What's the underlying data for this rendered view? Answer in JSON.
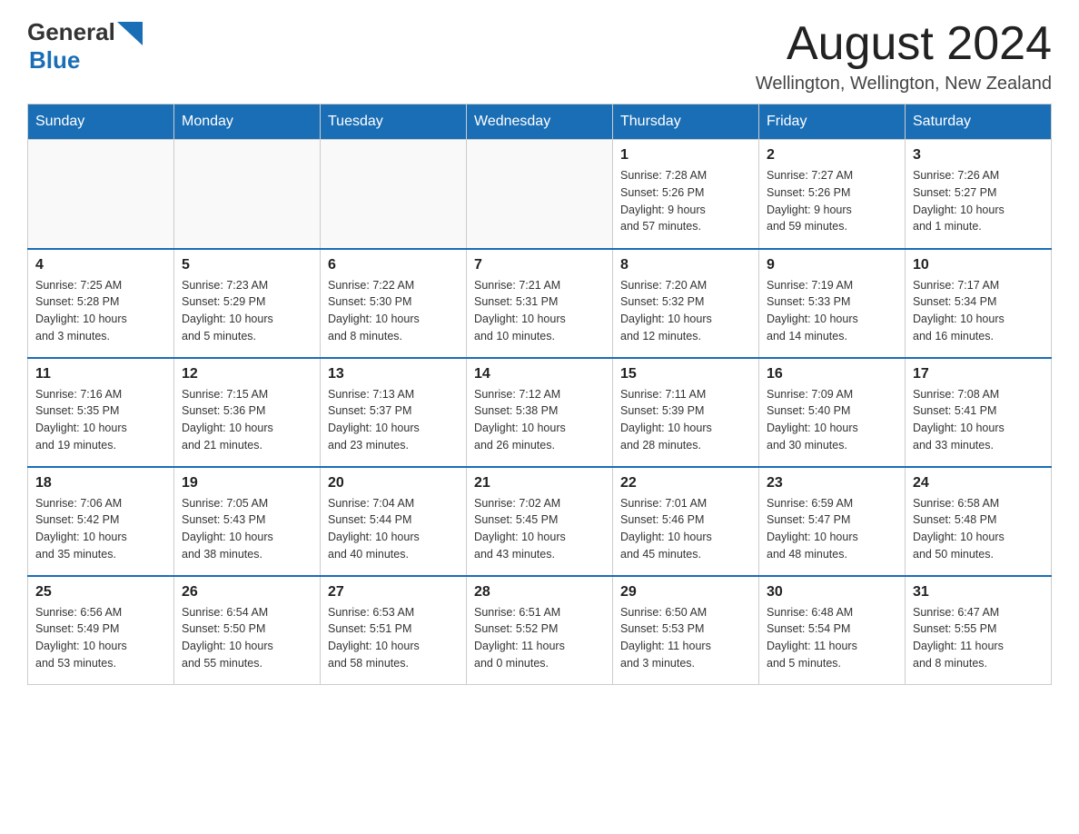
{
  "header": {
    "logo": {
      "general": "General",
      "blue": "Blue"
    },
    "title": "August 2024",
    "location": "Wellington, Wellington, New Zealand"
  },
  "calendar": {
    "days_of_week": [
      "Sunday",
      "Monday",
      "Tuesday",
      "Wednesday",
      "Thursday",
      "Friday",
      "Saturday"
    ],
    "weeks": [
      {
        "days": [
          {
            "date": "",
            "info": ""
          },
          {
            "date": "",
            "info": ""
          },
          {
            "date": "",
            "info": ""
          },
          {
            "date": "",
            "info": ""
          },
          {
            "date": "1",
            "info": "Sunrise: 7:28 AM\nSunset: 5:26 PM\nDaylight: 9 hours\nand 57 minutes."
          },
          {
            "date": "2",
            "info": "Sunrise: 7:27 AM\nSunset: 5:26 PM\nDaylight: 9 hours\nand 59 minutes."
          },
          {
            "date": "3",
            "info": "Sunrise: 7:26 AM\nSunset: 5:27 PM\nDaylight: 10 hours\nand 1 minute."
          }
        ]
      },
      {
        "days": [
          {
            "date": "4",
            "info": "Sunrise: 7:25 AM\nSunset: 5:28 PM\nDaylight: 10 hours\nand 3 minutes."
          },
          {
            "date": "5",
            "info": "Sunrise: 7:23 AM\nSunset: 5:29 PM\nDaylight: 10 hours\nand 5 minutes."
          },
          {
            "date": "6",
            "info": "Sunrise: 7:22 AM\nSunset: 5:30 PM\nDaylight: 10 hours\nand 8 minutes."
          },
          {
            "date": "7",
            "info": "Sunrise: 7:21 AM\nSunset: 5:31 PM\nDaylight: 10 hours\nand 10 minutes."
          },
          {
            "date": "8",
            "info": "Sunrise: 7:20 AM\nSunset: 5:32 PM\nDaylight: 10 hours\nand 12 minutes."
          },
          {
            "date": "9",
            "info": "Sunrise: 7:19 AM\nSunset: 5:33 PM\nDaylight: 10 hours\nand 14 minutes."
          },
          {
            "date": "10",
            "info": "Sunrise: 7:17 AM\nSunset: 5:34 PM\nDaylight: 10 hours\nand 16 minutes."
          }
        ]
      },
      {
        "days": [
          {
            "date": "11",
            "info": "Sunrise: 7:16 AM\nSunset: 5:35 PM\nDaylight: 10 hours\nand 19 minutes."
          },
          {
            "date": "12",
            "info": "Sunrise: 7:15 AM\nSunset: 5:36 PM\nDaylight: 10 hours\nand 21 minutes."
          },
          {
            "date": "13",
            "info": "Sunrise: 7:13 AM\nSunset: 5:37 PM\nDaylight: 10 hours\nand 23 minutes."
          },
          {
            "date": "14",
            "info": "Sunrise: 7:12 AM\nSunset: 5:38 PM\nDaylight: 10 hours\nand 26 minutes."
          },
          {
            "date": "15",
            "info": "Sunrise: 7:11 AM\nSunset: 5:39 PM\nDaylight: 10 hours\nand 28 minutes."
          },
          {
            "date": "16",
            "info": "Sunrise: 7:09 AM\nSunset: 5:40 PM\nDaylight: 10 hours\nand 30 minutes."
          },
          {
            "date": "17",
            "info": "Sunrise: 7:08 AM\nSunset: 5:41 PM\nDaylight: 10 hours\nand 33 minutes."
          }
        ]
      },
      {
        "days": [
          {
            "date": "18",
            "info": "Sunrise: 7:06 AM\nSunset: 5:42 PM\nDaylight: 10 hours\nand 35 minutes."
          },
          {
            "date": "19",
            "info": "Sunrise: 7:05 AM\nSunset: 5:43 PM\nDaylight: 10 hours\nand 38 minutes."
          },
          {
            "date": "20",
            "info": "Sunrise: 7:04 AM\nSunset: 5:44 PM\nDaylight: 10 hours\nand 40 minutes."
          },
          {
            "date": "21",
            "info": "Sunrise: 7:02 AM\nSunset: 5:45 PM\nDaylight: 10 hours\nand 43 minutes."
          },
          {
            "date": "22",
            "info": "Sunrise: 7:01 AM\nSunset: 5:46 PM\nDaylight: 10 hours\nand 45 minutes."
          },
          {
            "date": "23",
            "info": "Sunrise: 6:59 AM\nSunset: 5:47 PM\nDaylight: 10 hours\nand 48 minutes."
          },
          {
            "date": "24",
            "info": "Sunrise: 6:58 AM\nSunset: 5:48 PM\nDaylight: 10 hours\nand 50 minutes."
          }
        ]
      },
      {
        "days": [
          {
            "date": "25",
            "info": "Sunrise: 6:56 AM\nSunset: 5:49 PM\nDaylight: 10 hours\nand 53 minutes."
          },
          {
            "date": "26",
            "info": "Sunrise: 6:54 AM\nSunset: 5:50 PM\nDaylight: 10 hours\nand 55 minutes."
          },
          {
            "date": "27",
            "info": "Sunrise: 6:53 AM\nSunset: 5:51 PM\nDaylight: 10 hours\nand 58 minutes."
          },
          {
            "date": "28",
            "info": "Sunrise: 6:51 AM\nSunset: 5:52 PM\nDaylight: 11 hours\nand 0 minutes."
          },
          {
            "date": "29",
            "info": "Sunrise: 6:50 AM\nSunset: 5:53 PM\nDaylight: 11 hours\nand 3 minutes."
          },
          {
            "date": "30",
            "info": "Sunrise: 6:48 AM\nSunset: 5:54 PM\nDaylight: 11 hours\nand 5 minutes."
          },
          {
            "date": "31",
            "info": "Sunrise: 6:47 AM\nSunset: 5:55 PM\nDaylight: 11 hours\nand 8 minutes."
          }
        ]
      }
    ]
  }
}
